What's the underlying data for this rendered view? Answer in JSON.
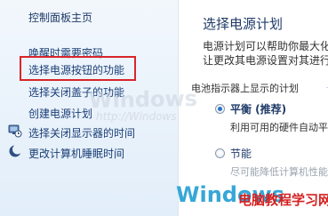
{
  "sidebar": {
    "home": "控制面板主页",
    "items": [
      {
        "label": "唤醒时需要密码",
        "icon": ""
      },
      {
        "label": "选择电源按钮的功能",
        "icon": ""
      },
      {
        "label": "选择关闭盖子的功能",
        "icon": ""
      },
      {
        "label": "创建电源计划",
        "icon": ""
      },
      {
        "label": "选择关闭显示器的时间",
        "icon": "display-clock-icon"
      },
      {
        "label": "更改计算机睡眠时间",
        "icon": "moon-sleep-icon"
      }
    ]
  },
  "main": {
    "title": "选择电源计划",
    "description_line1": "电源计划可以帮助你最大化",
    "description_line2": "让更改其电源设置对其进行",
    "section_label": "电池指示器上显示的计划",
    "plans": [
      {
        "name": "平衡 (推荐)",
        "desc": "利用可用的硬件自动平",
        "selected": true
      },
      {
        "name": "节能",
        "desc": "尽可能降低计算机性能",
        "selected": false
      }
    ]
  },
  "watermarks": {
    "big": "Windows",
    "url": "http://Windows",
    "bottom": "Windows",
    "site": "电脑教程学习网"
  },
  "colors": {
    "highlight_box": "#d8262b",
    "link": "#1e3a68",
    "sidebar_bg": "#e9f2fb",
    "radio_selected": "#2b71c6"
  }
}
